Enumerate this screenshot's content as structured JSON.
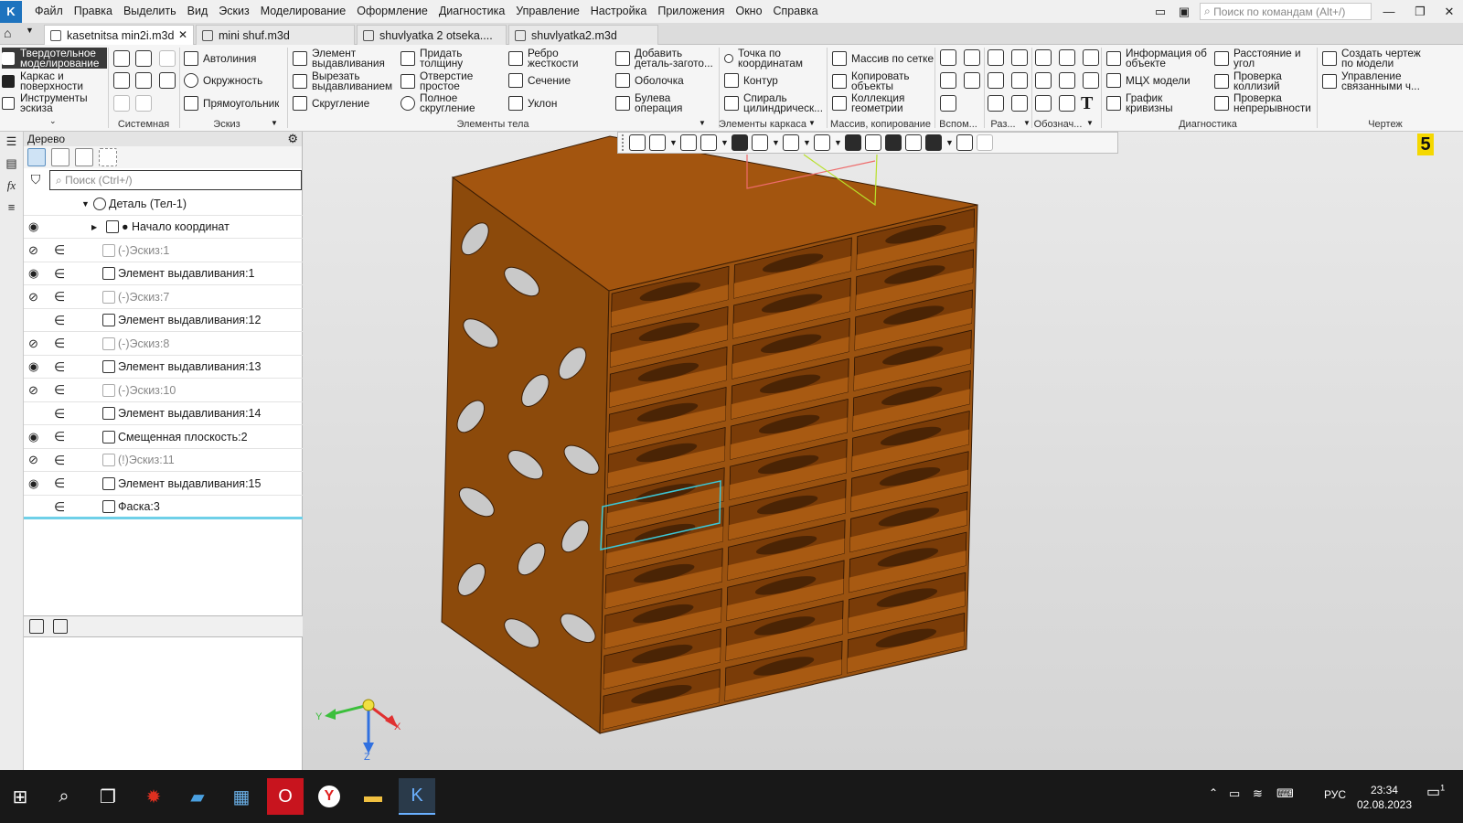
{
  "menubar": {
    "items": [
      "Файл",
      "Правка",
      "Выделить",
      "Вид",
      "Эскиз",
      "Моделирование",
      "Оформление",
      "Диагностика",
      "Управление",
      "Настройка",
      "Приложения",
      "Окно",
      "Справка"
    ],
    "search_placeholder": "Поиск по командам (Alt+/)"
  },
  "tabs": [
    {
      "label": "kasetnitsa min2i.m3d",
      "active": true
    },
    {
      "label": "mini shuf.m3d",
      "active": false
    },
    {
      "label": "shuvlyatka 2 otseka....",
      "active": false
    },
    {
      "label": "shuvlyatka2.m3d",
      "active": false
    }
  ],
  "ribbon": {
    "modes": [
      {
        "line1": "Твердотельное",
        "line2": "моделирование",
        "active": true
      },
      {
        "line1": "Каркас и",
        "line2": "поверхности",
        "active": false
      },
      {
        "line1": "Инструменты",
        "line2": "эскиза",
        "active": false
      }
    ],
    "sketch": {
      "autoline": "Автолиния",
      "circle": "Окружность",
      "rectangle": "Прямоугольник"
    },
    "body": {
      "extrude": [
        "Элемент",
        "выдавливания"
      ],
      "cut_extrude": [
        "Вырезать",
        "выдавливанием"
      ],
      "fillet": "Скругление",
      "thickness": [
        "Придать",
        "толщину"
      ],
      "simple_hole": [
        "Отверстие",
        "простое"
      ],
      "full_fillet": [
        "Полное",
        "скругление"
      ],
      "rib": [
        "Ребро",
        "жесткости"
      ],
      "section": "Сечение",
      "draft": "Уклон",
      "add_blank": [
        "Добавить",
        "деталь-загото..."
      ],
      "shell": "Оболочка",
      "boolean": [
        "Булева",
        "операция"
      ]
    },
    "frame": {
      "point": [
        "Точка по",
        "координатам"
      ],
      "contour": "Контур",
      "spiral": [
        "Спираль",
        "цилиндрическ..."
      ]
    },
    "array": {
      "grid": "Массив по сетке",
      "copy": [
        "Копировать",
        "объекты"
      ],
      "collection": [
        "Коллекция",
        "геометрии"
      ]
    },
    "diag": {
      "info": [
        "Информация об",
        "объекте"
      ],
      "mcx": "МЦХ модели",
      "curv": [
        "График",
        "кривизны"
      ],
      "dist": [
        "Расстояние и",
        "угол"
      ],
      "coll": [
        "Проверка",
        "коллизий"
      ],
      "cont": [
        "Проверка",
        "непрерывности"
      ]
    },
    "drawing": {
      "create": [
        "Создать чертеж",
        "по модели"
      ],
      "manage": [
        "Управление",
        "связанными ч..."
      ]
    },
    "groups": {
      "system": "Системная",
      "sketch": "Эскиз",
      "body": "Элементы тела",
      "frame": "Элементы каркаса",
      "array": "Массив, копирование",
      "aux": "Вспом...",
      "razm": "Раз...",
      "oboz": "Обознач...",
      "diag": "Диагностика",
      "drawing": "Чертеж"
    }
  },
  "tree": {
    "title": "Дерево",
    "search_placeholder": "Поиск (Ctrl+/)",
    "root": "Деталь (Тел-1)",
    "rows": [
      {
        "label": "● Начало координат",
        "eye": "visible",
        "inc": false,
        "gray": false,
        "indent": 1,
        "expander": true
      },
      {
        "label": "(-)Эскиз:1",
        "eye": "hidden",
        "inc": true,
        "gray": true,
        "indent": 2
      },
      {
        "label": "Элемент выдавливания:1",
        "eye": "visible",
        "inc": true,
        "gray": false,
        "indent": 2
      },
      {
        "label": "(-)Эскиз:7",
        "eye": "hidden",
        "inc": true,
        "gray": true,
        "indent": 2
      },
      {
        "label": "Элемент выдавливания:12",
        "eye": "none",
        "inc": true,
        "gray": false,
        "indent": 2
      },
      {
        "label": "(-)Эскиз:8",
        "eye": "hidden",
        "inc": true,
        "gray": true,
        "indent": 2
      },
      {
        "label": "Элемент выдавливания:13",
        "eye": "visible",
        "inc": true,
        "gray": false,
        "indent": 2
      },
      {
        "label": "(-)Эскиз:10",
        "eye": "hidden",
        "inc": true,
        "gray": true,
        "indent": 2
      },
      {
        "label": "Элемент выдавливания:14",
        "eye": "none",
        "inc": true,
        "gray": false,
        "indent": 2
      },
      {
        "label": "Смещенная плоскость:2",
        "eye": "visible",
        "inc": true,
        "gray": false,
        "indent": 2
      },
      {
        "label": "(!)Эскиз:11",
        "eye": "hidden",
        "inc": true,
        "gray": true,
        "indent": 2
      },
      {
        "label": "Элемент выдавливания:15",
        "eye": "visible",
        "inc": true,
        "gray": false,
        "indent": 2
      },
      {
        "label": "Фаска:3",
        "eye": "none",
        "inc": true,
        "gray": false,
        "indent": 2
      }
    ]
  },
  "viewport": {
    "badge": "5",
    "axes": {
      "x": "X",
      "y": "Y",
      "z": "Z"
    },
    "model_color": "#a0540f"
  },
  "taskbar": {
    "lang": "РУС",
    "time": "23:34",
    "date": "02.08.2023",
    "notif": "1"
  }
}
